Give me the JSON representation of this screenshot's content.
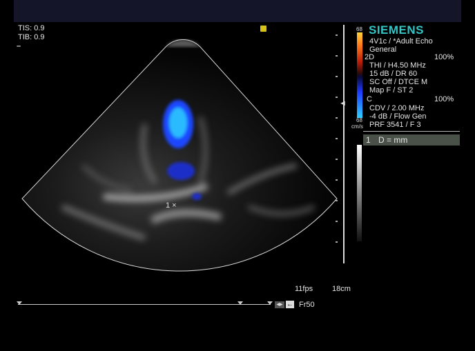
{
  "overlay": {
    "tis": "TIS: 0.9",
    "tib": "TIB: 0.9",
    "dash": "–"
  },
  "scale": {
    "top_value": "68",
    "bottom_value": "68",
    "unit": "cm/s",
    "marker": "◄"
  },
  "info_panel": {
    "brand": "SIEMENS",
    "transducer": "4V1c / *Adult Echo",
    "preset": "General",
    "mode_2d_label": "2D",
    "mode_2d_pct": "100%",
    "lines_2d": [
      "THI / H4.50 MHz",
      "15 dB / DR 60",
      "SC Off / DTCE M",
      "Map F / ST 2"
    ],
    "mode_c_label": "C",
    "mode_c_pct": "100%",
    "lines_c": [
      "CDV / 2.00 MHz",
      "-4 dB / Flow Gen",
      "PRF 3541 / F 3"
    ]
  },
  "measurement": {
    "index": "1",
    "label": "D = mm"
  },
  "cursor_label": "1 ×",
  "status": {
    "fps": "11fps",
    "depth": "18cm",
    "frame": "Fr50",
    "cine_badge": "◀▶",
    "back_arrow": "←"
  },
  "colors": {
    "brand": "#33c6c6",
    "flow_blue": "#1e46ff",
    "flow_cyan": "#2fd0ff",
    "panel_gray": "#4a5148",
    "top_bar": "#15152a"
  }
}
